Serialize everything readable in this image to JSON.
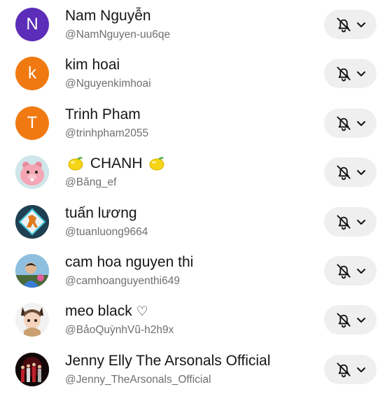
{
  "accounts": [
    {
      "name": "Nam Nguyễn",
      "handle": "@NamNguyen-uu6qe",
      "initial": "N",
      "avatar_color": "#5b2db8"
    },
    {
      "name": "kim hoai",
      "handle": "@Nguyenkimhoai",
      "initial": "k",
      "avatar_color": "#f07a11"
    },
    {
      "name": "Trinh Pham",
      "handle": "@trinhpham2055",
      "initial": "T",
      "avatar_color": "#f07a11"
    },
    {
      "name": "CHANH",
      "handle": "@Băng_ef",
      "avatar_icon": "pink-beaver-avatar",
      "name_emoji": "lemon-emoji"
    },
    {
      "name": "tuấn lương",
      "handle": "@tuanluong9664",
      "avatar_icon": "horse-logo-avatar"
    },
    {
      "name": "cam hoa nguyen thi",
      "handle": "@camhoanguyenthi649",
      "avatar_icon": "person-photo-avatar"
    },
    {
      "name": "meo black",
      "name_suffix": "♡",
      "handle": "@BảoQuỳnhVũ-h2h9x",
      "avatar_icon": "anime-fox-avatar"
    },
    {
      "name": "Jenny Elly The Arsonals Official",
      "handle": "@Jenny_TheArsonals_Official",
      "avatar_icon": "band-photo-avatar"
    }
  ],
  "notification_button": {
    "icon": "bell-off-icon",
    "dropdown_icon": "chevron-down-icon"
  },
  "colors": {
    "button_bg": "#efefef",
    "name_text": "#161616",
    "handle_text": "#6f6f6f"
  }
}
